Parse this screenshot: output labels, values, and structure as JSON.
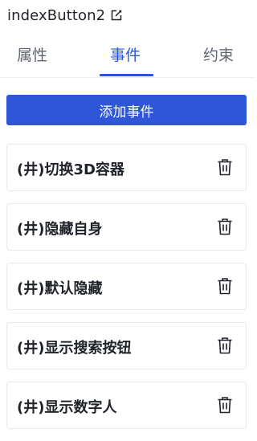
{
  "header": {
    "title": "indexButton2",
    "edit_icon": "edit-icon"
  },
  "tabs": [
    {
      "label": "属性",
      "active": false
    },
    {
      "label": "事件",
      "active": true
    },
    {
      "label": "约束",
      "active": false
    }
  ],
  "add_button_label": "添加事件",
  "events": [
    {
      "label": "(井)切换3D容器",
      "delete_icon": "trash-icon"
    },
    {
      "label": "(井)隐藏自身",
      "delete_icon": "trash-icon"
    },
    {
      "label": "(井)默认隐藏",
      "delete_icon": "trash-icon"
    },
    {
      "label": "(井)显示搜索按钮",
      "delete_icon": "trash-icon"
    },
    {
      "label": "(井)显示数字人",
      "delete_icon": "trash-icon"
    }
  ],
  "colors": {
    "accent": "#2b55d8",
    "button": "#2e56d6",
    "border": "#e6e9ee"
  }
}
